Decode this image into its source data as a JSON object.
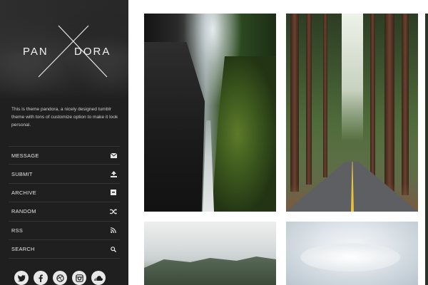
{
  "sidebar": {
    "logo": {
      "left": "PAN",
      "right": "DORA"
    },
    "intro": "This is theme pandora, a nicely designed tumblr theme with tons of customize option to make it look personal.",
    "menu": [
      {
        "label": "MESSAGE",
        "icon": "envelope-icon"
      },
      {
        "label": "SUBMIT",
        "icon": "upload-icon"
      },
      {
        "label": "ARCHIVE",
        "icon": "archive-icon"
      },
      {
        "label": "RANDOM",
        "icon": "shuffle-icon"
      },
      {
        "label": "RSS",
        "icon": "rss-icon"
      },
      {
        "label": "SEARCH",
        "icon": "search-icon"
      }
    ],
    "social": [
      "twitter-icon",
      "facebook-icon",
      "dribbble-icon",
      "instagram-icon",
      "soundcloud-icon"
    ]
  },
  "photos": [
    {
      "name": "waterfall-gorge-photo"
    },
    {
      "name": "redwood-road-photo"
    },
    {
      "name": "coastal-cliffs-photo"
    },
    {
      "name": "cloudy-sky-photo"
    }
  ],
  "colors": {
    "sidebar_bg": "#1f1f1f",
    "text": "#e6e6e6",
    "divider": "#333333",
    "page_bg": "#ffffff"
  }
}
